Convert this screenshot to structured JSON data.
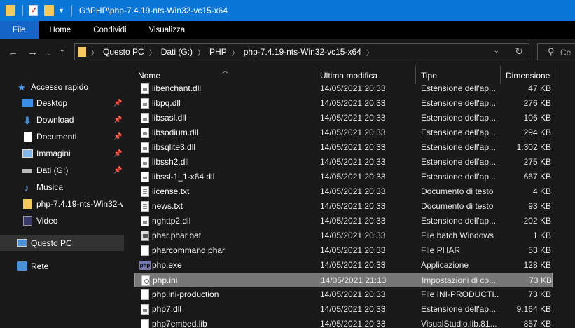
{
  "window": {
    "title": "G:\\PHP\\php-7.4.19-nts-Win32-vc15-x64",
    "accent": "#0a76d8"
  },
  "ribbon": {
    "tabs": [
      "File",
      "Home",
      "Condividi",
      "Visualizza"
    ]
  },
  "address": {
    "crumbs": [
      "Questo PC",
      "Dati (G:)",
      "PHP",
      "php-7.4.19-nts-Win32-vc15-x64"
    ],
    "search_placeholder": "Ce"
  },
  "sidebar": {
    "items": [
      {
        "label": "Accesso rapido",
        "icon": "star-icon"
      },
      {
        "label": "Desktop",
        "icon": "desktop-icon",
        "pinned": true
      },
      {
        "label": "Download",
        "icon": "download-arrow-icon",
        "pinned": true
      },
      {
        "label": "Documenti",
        "icon": "document-icon",
        "pinned": true
      },
      {
        "label": "Immagini",
        "icon": "image-icon",
        "pinned": true
      },
      {
        "label": "Dati (G:)",
        "icon": "drive-icon",
        "pinned": true
      },
      {
        "label": "Musica",
        "icon": "music-note-icon"
      },
      {
        "label": "php-7.4.19-nts-Win32-v",
        "icon": "folder-icon"
      },
      {
        "label": "Video",
        "icon": "video-icon"
      },
      {
        "label": "Questo PC",
        "icon": "computer-icon",
        "selected": true
      },
      {
        "label": "Rete",
        "icon": "network-icon"
      }
    ]
  },
  "columns": {
    "name": "Nome",
    "date": "Ultima modifica",
    "type": "Tipo",
    "size": "Dimensione"
  },
  "files": [
    {
      "name": "libenchant.dll",
      "date": "14/05/2021 20:33",
      "type": "Estensione dell'ap...",
      "size": "47 KB",
      "icon": "dll"
    },
    {
      "name": "libpq.dll",
      "date": "14/05/2021 20:33",
      "type": "Estensione dell'ap...",
      "size": "276 KB",
      "icon": "dll"
    },
    {
      "name": "libsasl.dll",
      "date": "14/05/2021 20:33",
      "type": "Estensione dell'ap...",
      "size": "106 KB",
      "icon": "dll"
    },
    {
      "name": "libsodium.dll",
      "date": "14/05/2021 20:33",
      "type": "Estensione dell'ap...",
      "size": "294 KB",
      "icon": "dll"
    },
    {
      "name": "libsqlite3.dll",
      "date": "14/05/2021 20:33",
      "type": "Estensione dell'ap...",
      "size": "1.302 KB",
      "icon": "dll"
    },
    {
      "name": "libssh2.dll",
      "date": "14/05/2021 20:33",
      "type": "Estensione dell'ap...",
      "size": "275 KB",
      "icon": "dll"
    },
    {
      "name": "libssl-1_1-x64.dll",
      "date": "14/05/2021 20:33",
      "type": "Estensione dell'ap...",
      "size": "667 KB",
      "icon": "dll"
    },
    {
      "name": "license.txt",
      "date": "14/05/2021 20:33",
      "type": "Documento di testo",
      "size": "4 KB",
      "icon": "txt"
    },
    {
      "name": "news.txt",
      "date": "14/05/2021 20:33",
      "type": "Documento di testo",
      "size": "93 KB",
      "icon": "txt"
    },
    {
      "name": "nghttp2.dll",
      "date": "14/05/2021 20:33",
      "type": "Estensione dell'ap...",
      "size": "202 KB",
      "icon": "dll"
    },
    {
      "name": "phar.phar.bat",
      "date": "14/05/2021 20:33",
      "type": "File batch Windows",
      "size": "1 KB",
      "icon": "bat"
    },
    {
      "name": "pharcommand.phar",
      "date": "14/05/2021 20:33",
      "type": "File PHAR",
      "size": "53 KB",
      "icon": "blank"
    },
    {
      "name": "php.exe",
      "date": "14/05/2021 20:33",
      "type": "Applicazione",
      "size": "128 KB",
      "icon": "php"
    },
    {
      "name": "php.ini",
      "date": "14/05/2021 21:13",
      "type": "Impostazioni di co...",
      "size": "73 KB",
      "icon": "ini",
      "selected": true
    },
    {
      "name": "php.ini-production",
      "date": "14/05/2021 20:33",
      "type": "File INI-PRODUCTI...",
      "size": "73 KB",
      "icon": "blank"
    },
    {
      "name": "php7.dll",
      "date": "14/05/2021 20:33",
      "type": "Estensione dell'ap...",
      "size": "9.164 KB",
      "icon": "dll"
    },
    {
      "name": "php7embed.lib",
      "date": "14/05/2021 20:33",
      "type": "VisualStudio.lib.81...",
      "size": "857 KB",
      "icon": "blank"
    }
  ]
}
